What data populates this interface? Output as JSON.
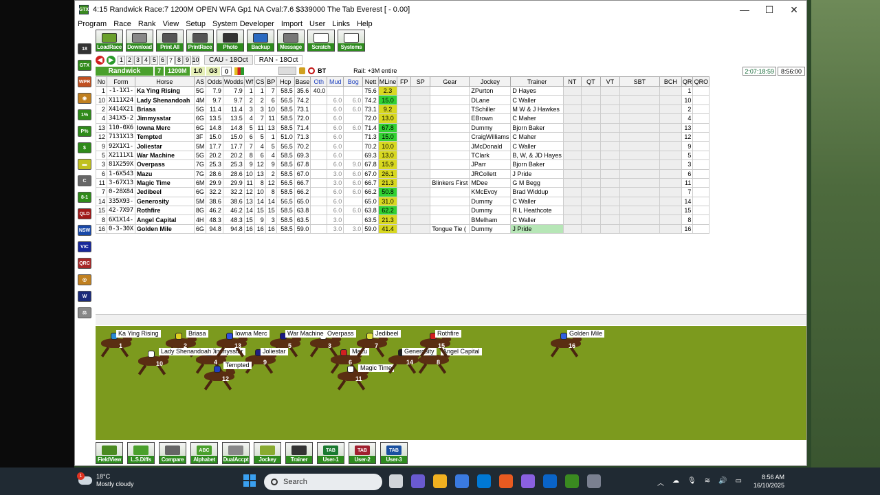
{
  "window": {
    "title": "4:15 Randwick Race:7 1200M   OPEN WFA Gp1  NA Cval:7.6 $339000 The Tab Everest [ - 0.00]",
    "app_icon": "GTX",
    "minimize": "—",
    "maximize": "☐",
    "close": "✕"
  },
  "menu": [
    "Program",
    "Race",
    "Rank",
    "View",
    "Setup",
    "System Developer",
    "Import",
    "User",
    "Links",
    "Help"
  ],
  "toolbar": [
    {
      "label": "LoadRace",
      "color": "#6aa02c"
    },
    {
      "label": "Download",
      "color": "#888888"
    },
    {
      "label": "Print All",
      "color": "#555555"
    },
    {
      "label": "PrintRace",
      "color": "#555555"
    },
    {
      "label": "Photo",
      "color": "#333333"
    },
    {
      "label": "Backup",
      "color": "#2a6ac0"
    },
    {
      "label": "Message",
      "color": "#777777"
    },
    {
      "label": "Scratch",
      "color": "#ffffff"
    },
    {
      "label": "Systems",
      "color": "#ffffff"
    }
  ],
  "leftbar": [
    {
      "label": "18",
      "color": "#333333"
    },
    {
      "label": "GTX",
      "color": "#2f8a1a"
    },
    {
      "label": "WPR",
      "color": "#c05020"
    },
    {
      "label": "◉",
      "color": "#c08020"
    },
    {
      "label": "1%",
      "color": "#2f8a1a"
    },
    {
      "label": "P%",
      "color": "#2f8a1a"
    },
    {
      "label": "$",
      "color": "#2f8a1a"
    },
    {
      "label": "▬",
      "color": "#c0c020"
    },
    {
      "label": "C",
      "color": "#666666"
    },
    {
      "label": "8-1",
      "color": "#2f8a1a"
    },
    {
      "label": "QLD",
      "color": "#a01818"
    },
    {
      "label": "NSW",
      "color": "#1848a8"
    },
    {
      "label": "VIC",
      "color": "#18289a"
    },
    {
      "label": "QRC",
      "color": "#a82828"
    },
    {
      "label": "◎",
      "color": "#c08020"
    },
    {
      "label": "W",
      "color": "#1a2a7a"
    },
    {
      "label": "⚖",
      "color": "#888888"
    }
  ],
  "race_tabs": [
    "1",
    "2",
    "3",
    "4",
    "5",
    "6",
    "7",
    "8",
    "9",
    "10"
  ],
  "active_race_tab": "7",
  "meet_tabs": [
    "CAU - 18Oct",
    "RAN - 18Oct"
  ],
  "info": {
    "venue": "Randwick",
    "race": "7",
    "distance": "1200M",
    "rating": "1.0",
    "group": "G3",
    "count": "0",
    "bt": "BT",
    "rail": "Rail: +3M entire",
    "timer": "2:07:18:59",
    "time": "8:56:00"
  },
  "columns": [
    "No",
    "Form",
    "Horse",
    "AS",
    "Odds",
    "Wodds",
    "Wf",
    "CS",
    "BP",
    "Hcp",
    "Base",
    "Oth",
    "Mud",
    "Bog",
    "Nett",
    "MLine",
    "FP",
    "SP",
    "Gear",
    "Jockey",
    "Trainer",
    "NT",
    "QT",
    "VT",
    "SBT",
    "BCH",
    "QR",
    "QRO"
  ],
  "runners": [
    {
      "no": "1",
      "form": "-1-1X1-",
      "horse": "Ka Ying Rising",
      "as": "5G",
      "odds": "7.9",
      "wodds": "7.9",
      "wf": "1",
      "cs": "1",
      "bp": "7",
      "hcp": "58.5",
      "base": "35.6",
      "oth": "40.0",
      "mud": "",
      "bog": "",
      "nett": "75.6",
      "mline": "2.3",
      "mc": "y",
      "gear": "",
      "jockey": "ZPurton",
      "trainer": "D Hayes",
      "qr": "1"
    },
    {
      "no": "10",
      "form": "X111X24",
      "horse": "Lady Shenandoah",
      "as": "4M",
      "odds": "9.7",
      "wodds": "9.7",
      "wf": "2",
      "cs": "2",
      "bp": "6",
      "hcp": "56.5",
      "base": "74.2",
      "oth": "",
      "mud": "6.0",
      "bog": "6.0",
      "nett": "74.2",
      "mline": "15.0",
      "mc": "g",
      "gear": "",
      "jockey": "DLane",
      "trainer": "C Waller",
      "qr": "10"
    },
    {
      "no": "2",
      "form": "X414X21",
      "horse": "Briasa",
      "as": "5G",
      "odds": "11.4",
      "wodds": "11.4",
      "wf": "3",
      "cs": "3",
      "bp": "10",
      "hcp": "58.5",
      "base": "73.1",
      "oth": "",
      "mud": "6.0",
      "bog": "6.0",
      "nett": "73.1",
      "mline": "9.2",
      "mc": "y",
      "gear": "",
      "jockey": "TSchiller",
      "trainer": "M W & J Hawkes",
      "qr": "2"
    },
    {
      "no": "4",
      "form": "341X5-2",
      "horse": "Jimmysstar",
      "as": "6G",
      "odds": "13.5",
      "wodds": "13.5",
      "wf": "4",
      "cs": "7",
      "bp": "11",
      "hcp": "58.5",
      "base": "72.0",
      "oth": "",
      "mud": "6.0",
      "bog": "",
      "nett": "72.0",
      "mline": "13.0",
      "mc": "y",
      "gear": "",
      "jockey": "EBrown",
      "trainer": "C Maher",
      "qr": "4"
    },
    {
      "no": "13",
      "form": "110-0X6",
      "horse": "Iowna Merc",
      "as": "6G",
      "odds": "14.8",
      "wodds": "14.8",
      "wf": "5",
      "cs": "11",
      "bp": "13",
      "hcp": "58.5",
      "base": "71.4",
      "oth": "",
      "mud": "6.0",
      "bog": "6.0",
      "nett": "71.4",
      "mline": "67.8",
      "mc": "g",
      "gear": "",
      "jockey": "Dummy",
      "trainer": "Bjorn Baker",
      "qr": "13"
    },
    {
      "no": "12",
      "form": "7131X13",
      "horse": "Tempted",
      "as": "3F",
      "odds": "15.0",
      "wodds": "15.0",
      "wf": "6",
      "cs": "5",
      "bp": "1",
      "hcp": "51.0",
      "base": "71.3",
      "oth": "",
      "mud": "6.0",
      "bog": "",
      "nett": "71.3",
      "mline": "15.0",
      "mc": "g",
      "gear": "",
      "jockey": "CraigWilliams",
      "trainer": "C Maher",
      "qr": "12"
    },
    {
      "no": "9",
      "form": "92X1X1-",
      "horse": "Joliestar",
      "as": "5M",
      "odds": "17.7",
      "wodds": "17.7",
      "wf": "7",
      "cs": "4",
      "bp": "5",
      "hcp": "56.5",
      "base": "70.2",
      "oth": "",
      "mud": "6.0",
      "bog": "",
      "nett": "70.2",
      "mline": "10.0",
      "mc": "y",
      "gear": "",
      "jockey": "JMcDonald",
      "trainer": "C Waller",
      "qr": "9"
    },
    {
      "no": "5",
      "form": "X2111X1",
      "horse": "War Machine",
      "as": "5G",
      "odds": "20.2",
      "wodds": "20.2",
      "wf": "8",
      "cs": "6",
      "bp": "4",
      "hcp": "58.5",
      "base": "69.3",
      "oth": "",
      "mud": "6.0",
      "bog": "",
      "nett": "69.3",
      "mline": "13.0",
      "mc": "y",
      "gear": "",
      "jockey": "TClark",
      "trainer": "B, W, & JD Hayes",
      "qr": "5"
    },
    {
      "no": "3",
      "form": "81X259X",
      "horse": "Overpass",
      "as": "7G",
      "odds": "25.3",
      "wodds": "25.3",
      "wf": "9",
      "cs": "12",
      "bp": "9",
      "hcp": "58.5",
      "base": "67.8",
      "oth": "",
      "mud": "6.0",
      "bog": "9.0",
      "nett": "67.8",
      "mline": "15.9",
      "mc": "y",
      "gear": "",
      "jockey": "JParr",
      "trainer": "Bjorn Baker",
      "qr": "3"
    },
    {
      "no": "6",
      "form": "1-6X543",
      "horse": "Mazu",
      "as": "7G",
      "odds": "28.6",
      "wodds": "28.6",
      "wf": "10",
      "cs": "13",
      "bp": "2",
      "hcp": "58.5",
      "base": "67.0",
      "oth": "",
      "mud": "3.0",
      "bog": "6.0",
      "nett": "67.0",
      "mline": "26.1",
      "mc": "y",
      "gear": "",
      "jockey": "JRCollett",
      "trainer": "J Pride",
      "qr": "6"
    },
    {
      "no": "11",
      "form": "3-67X13",
      "horse": "Magic Time",
      "as": "6M",
      "odds": "29.9",
      "wodds": "29.9",
      "wf": "11",
      "cs": "8",
      "bp": "12",
      "hcp": "56.5",
      "base": "66.7",
      "oth": "",
      "mud": "3.0",
      "bog": "6.0",
      "nett": "66.7",
      "mline": "21.3",
      "mc": "y",
      "gear": "Blinkers First",
      "jockey": "MDee",
      "trainer": "G M Begg",
      "qr": "11"
    },
    {
      "no": "7",
      "form": "0-28X84",
      "horse": "Jedibeel",
      "as": "6G",
      "odds": "32.2",
      "wodds": "32.2",
      "wf": "12",
      "cs": "10",
      "bp": "8",
      "hcp": "58.5",
      "base": "66.2",
      "oth": "",
      "mud": "6.0",
      "bog": "6.0",
      "nett": "66.2",
      "mline": "50.8",
      "mc": "g",
      "gear": "",
      "jockey": "KMcEvoy",
      "trainer": "Brad Widdup",
      "qr": "7"
    },
    {
      "no": "14",
      "form": "335X93-",
      "horse": "Generosity",
      "as": "5M",
      "odds": "38.6",
      "wodds": "38.6",
      "wf": "13",
      "cs": "14",
      "bp": "14",
      "hcp": "56.5",
      "base": "65.0",
      "oth": "",
      "mud": "6.0",
      "bog": "",
      "nett": "65.0",
      "mline": "31.0",
      "mc": "y",
      "gear": "",
      "jockey": "Dummy",
      "trainer": "C Waller",
      "qr": "14"
    },
    {
      "no": "15",
      "form": "42-7X97",
      "horse": "Rothfire",
      "as": "8G",
      "odds": "46.2",
      "wodds": "46.2",
      "wf": "14",
      "cs": "15",
      "bp": "15",
      "hcp": "58.5",
      "base": "63.8",
      "oth": "",
      "mud": "6.0",
      "bog": "6.0",
      "nett": "63.8",
      "mline": "62.2",
      "mc": "g",
      "gear": "",
      "jockey": "Dummy",
      "trainer": "R L Heathcote",
      "qr": "15"
    },
    {
      "no": "8",
      "form": "6X1X14-",
      "horse": "Angel Capital",
      "as": "4H",
      "odds": "48.3",
      "wodds": "48.3",
      "wf": "15",
      "cs": "9",
      "bp": "3",
      "hcp": "58.5",
      "base": "63.5",
      "oth": "",
      "mud": "3.0",
      "bog": "",
      "nett": "63.5",
      "mline": "21.3",
      "mc": "y",
      "gear": "",
      "jockey": "BMelham",
      "trainer": "C Waller",
      "qr": "8"
    },
    {
      "no": "16",
      "form": "0-3-30X",
      "horse": "Golden Mile",
      "as": "6G",
      "odds": "94.8",
      "wodds": "94.8",
      "wf": "16",
      "cs": "16",
      "bp": "16",
      "hcp": "58.5",
      "base": "59.0",
      "oth": "",
      "mud": "3.0",
      "bog": "3.0",
      "nett": "59.0",
      "mline": "41.4",
      "mc": "y",
      "gear": "Tongue Tie (",
      "jockey": "Dummy",
      "trainer": "J Pride",
      "qr": "16"
    }
  ],
  "track": [
    {
      "name": "Ka Ying Rising",
      "num": "1",
      "silk": "#2a8ad0"
    },
    {
      "name": "Briasa",
      "num": "2",
      "silk": "#e0d020"
    },
    {
      "name": "Overpass",
      "num": "3",
      "silk": "#ffffff"
    },
    {
      "name": "Jimmysstar",
      "num": "4",
      "silk": "#2030a0"
    },
    {
      "name": "War Machine",
      "num": "5",
      "silk": "#1a1a80"
    },
    {
      "name": "Mazu",
      "num": "6",
      "silk": "#d02020"
    },
    {
      "name": "Jedibeel",
      "num": "7",
      "silk": "#e0e040"
    },
    {
      "name": "Angel Capital",
      "num": "8",
      "silk": "#20a060"
    },
    {
      "name": "Joliestar",
      "num": "9",
      "silk": "#202080"
    },
    {
      "name": "Lady Shenandoah",
      "num": "10",
      "silk": "#ffffff"
    },
    {
      "name": "Magic Time",
      "num": "11",
      "silk": "#ffffff"
    },
    {
      "name": "Tempted",
      "num": "12",
      "silk": "#2040c0"
    },
    {
      "name": "Iowna Merc",
      "num": "13",
      "silk": "#3050e0"
    },
    {
      "name": "Generosity",
      "num": "14",
      "silk": "#202020"
    },
    {
      "name": "Rothfire",
      "num": "15",
      "silk": "#d02020"
    },
    {
      "name": "Golden Mile",
      "num": "16",
      "silk": "#3060e0"
    }
  ],
  "bottombar": [
    {
      "label": "FieldView",
      "icon": "",
      "color": "#4a8a20"
    },
    {
      "label": "L.S.Diffs",
      "icon": "",
      "color": "#4aa02c"
    },
    {
      "label": "Compare",
      "icon": "",
      "color": "#666666"
    },
    {
      "label": "Alphabet",
      "icon": "ABC",
      "color": "#4aa02c"
    },
    {
      "label": "DualAccpt",
      "icon": "",
      "color": "#888888"
    },
    {
      "label": "Jockey",
      "icon": "",
      "color": "#88aa30"
    },
    {
      "label": "Trainer",
      "icon": "",
      "color": "#333333"
    },
    {
      "label": "User-1",
      "icon": "TAB",
      "color": "#1a7a30"
    },
    {
      "label": "User-2",
      "icon": "TAB",
      "color": "#a02030"
    },
    {
      "label": "User-3",
      "icon": "TAB",
      "color": "#1a50a0"
    }
  ],
  "taskbar": {
    "temp": "18°C",
    "weather": "Mostly cloudy",
    "badge": "1",
    "search": "Search",
    "time": "8:56 AM",
    "date": "16/10/2025",
    "apps": [
      "#d0d4d8",
      "#6a5ad0",
      "#f0b020",
      "#3a7ae0",
      "#0078d4",
      "#e85a20",
      "#8a60e0",
      "#0a64c8",
      "#3a8a20",
      "#7a8090"
    ]
  }
}
